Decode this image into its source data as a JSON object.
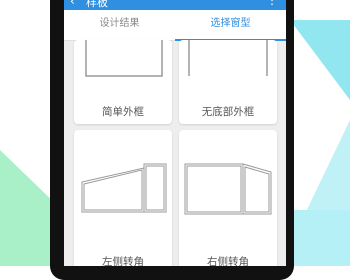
{
  "appbar": {
    "back_icon": "back-arrow-icon",
    "title": "样板",
    "more_icon": "more-vertical-icon"
  },
  "tabs": [
    {
      "label": "设计结果",
      "active": false
    },
    {
      "label": "选择窗型",
      "active": true
    }
  ],
  "cards": [
    {
      "label": "简单外框"
    },
    {
      "label": "无底部外框"
    },
    {
      "label": "左侧转角"
    },
    {
      "label": "右侧转角"
    }
  ],
  "colors": {
    "accent": "#2f8fe0",
    "background": "#eeeeee"
  }
}
